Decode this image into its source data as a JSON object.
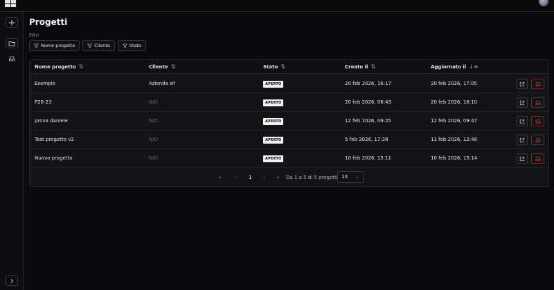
{
  "page": {
    "title": "Progetti"
  },
  "filters": {
    "label": "Filtri",
    "buttons": [
      "Nome progetto",
      "Cliente",
      "Stato"
    ]
  },
  "table": {
    "headers": [
      "Nome progetto",
      "Cliente",
      "Stato",
      "Creato il",
      "Aggiornato il"
    ],
    "rows": [
      {
        "name": "Esempio",
        "client": "Azienda srl",
        "status": "APERTO",
        "created": "20 feb 2026, 16:17",
        "updated": "20 feb 2026, 17:05"
      },
      {
        "name": "P26-23",
        "client": "N/D",
        "status": "APERTO",
        "created": "20 feb 2026, 06:43",
        "updated": "20 feb 2026, 16:10"
      },
      {
        "name": "prova daniele",
        "client": "N/D",
        "status": "APERTO",
        "created": "12 feb 2026, 09:25",
        "updated": "12 feb 2026, 09:47"
      },
      {
        "name": "Test progetto v2",
        "client": "N/D",
        "status": "APERTO",
        "created": "5 feb 2026, 17:38",
        "updated": "11 feb 2026, 12:48"
      },
      {
        "name": "Nuovo progetto",
        "client": "N/D",
        "status": "APERTO",
        "created": "10 feb 2026, 15:11",
        "updated": "10 feb 2026, 15:14"
      }
    ]
  },
  "pagination": {
    "first": "«",
    "prev": "‹",
    "current_page": "1",
    "next": "›",
    "last": "»",
    "summary": "Da 1 a 5 di 5 progetti",
    "page_size": "10"
  },
  "icons": {
    "sort": "⇅",
    "sort_desc": "↓≡",
    "chevron_down": "⌄"
  },
  "colors": {
    "accent_danger": "#c0392b",
    "badge_bg": "#f2f2f2"
  }
}
